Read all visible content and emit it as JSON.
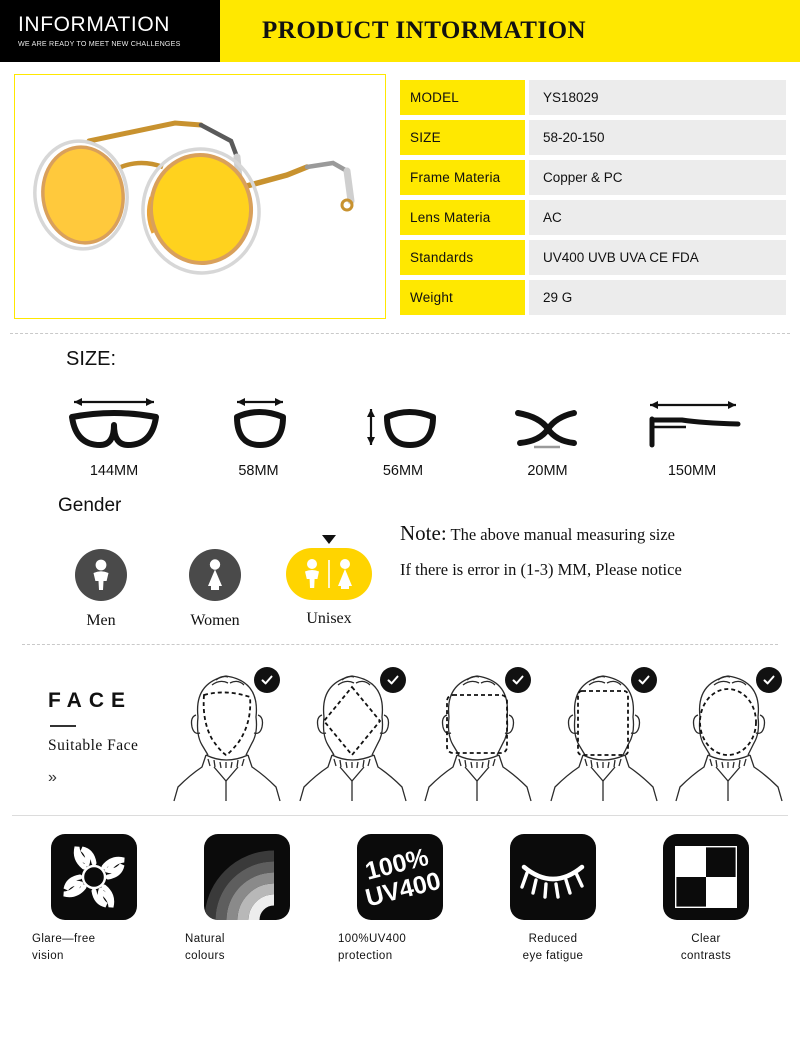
{
  "header": {
    "logo_title": "INFORMATION",
    "logo_tagline": "WE ARE READY TO MEET NEW CHALLENGES",
    "title": "PRODUCT  INTORMATION",
    "band_color": "#FFE800",
    "logo_bg": "#000000"
  },
  "product_photo": {
    "alt": "yellow-tinted-sunglasses",
    "lens_color": "#FFD21E",
    "frame_color": "#D9A05B",
    "border_color": "#FFE800"
  },
  "spec_table": {
    "rows": [
      {
        "key": "MODEL",
        "value": "YS18029"
      },
      {
        "key": "SIZE",
        "value": "58-20-150"
      },
      {
        "key": "Frame  Materia",
        "value": "Copper  &  PC"
      },
      {
        "key": "Lens    Materia",
        "value": "AC"
      },
      {
        "key": "Standards",
        "value": "UV400  UVB  UVA  CE  FDA"
      },
      {
        "key": "Weight",
        "value": "29  G"
      }
    ],
    "key_bg": "#FFE800",
    "value_bg": "#ECECEC"
  },
  "size_section": {
    "title": "SIZE:",
    "items": [
      {
        "icon": "glasses-front-icon",
        "label": "144MM"
      },
      {
        "icon": "lens-width-icon",
        "label": "58MM"
      },
      {
        "icon": "lens-height-icon",
        "label": "56MM"
      },
      {
        "icon": "bridge-width-icon",
        "label": "20MM"
      },
      {
        "icon": "temple-arm-icon",
        "label": "150MM"
      }
    ]
  },
  "gender_section": {
    "title": "Gender",
    "options": [
      {
        "icon": "man-icon",
        "label": "Men",
        "selected": false
      },
      {
        "icon": "woman-icon",
        "label": "Women",
        "selected": false
      },
      {
        "icon": "unisex-icon",
        "label": "Unisex",
        "selected": true
      }
    ],
    "selected_color": "#FFD400",
    "unselected_color": "#4A4A4A"
  },
  "note": {
    "label": "Note:",
    "line1": "The above manual measuring size",
    "line2": "If there is error in (1-3) MM, Please notice"
  },
  "face_section": {
    "heading": "FACE",
    "subheading": "Suitable  Face",
    "chevron": "»",
    "faces": [
      {
        "shape": "heart-face-icon",
        "check": "✓"
      },
      {
        "shape": "diamond-face-icon",
        "check": "✓"
      },
      {
        "shape": "square-face-icon",
        "check": "✓"
      },
      {
        "shape": "rectangle-face-icon",
        "check": "✓"
      },
      {
        "shape": "oval-face-icon",
        "check": "✓"
      }
    ]
  },
  "features": [
    {
      "icon": "sun-glare-icon",
      "line1": "Glare—free",
      "line2": "vision"
    },
    {
      "icon": "rainbow-icon",
      "line1": "Natural",
      "line2": "colours"
    },
    {
      "icon": "uv400-icon",
      "line1": "100%UV400",
      "line2": "protection"
    },
    {
      "icon": "closed-eye-icon",
      "line1": "Reduced",
      "line2": "eye fatigue"
    },
    {
      "icon": "checkerboard-icon",
      "line1": "Clear",
      "line2": "contrasts"
    }
  ]
}
